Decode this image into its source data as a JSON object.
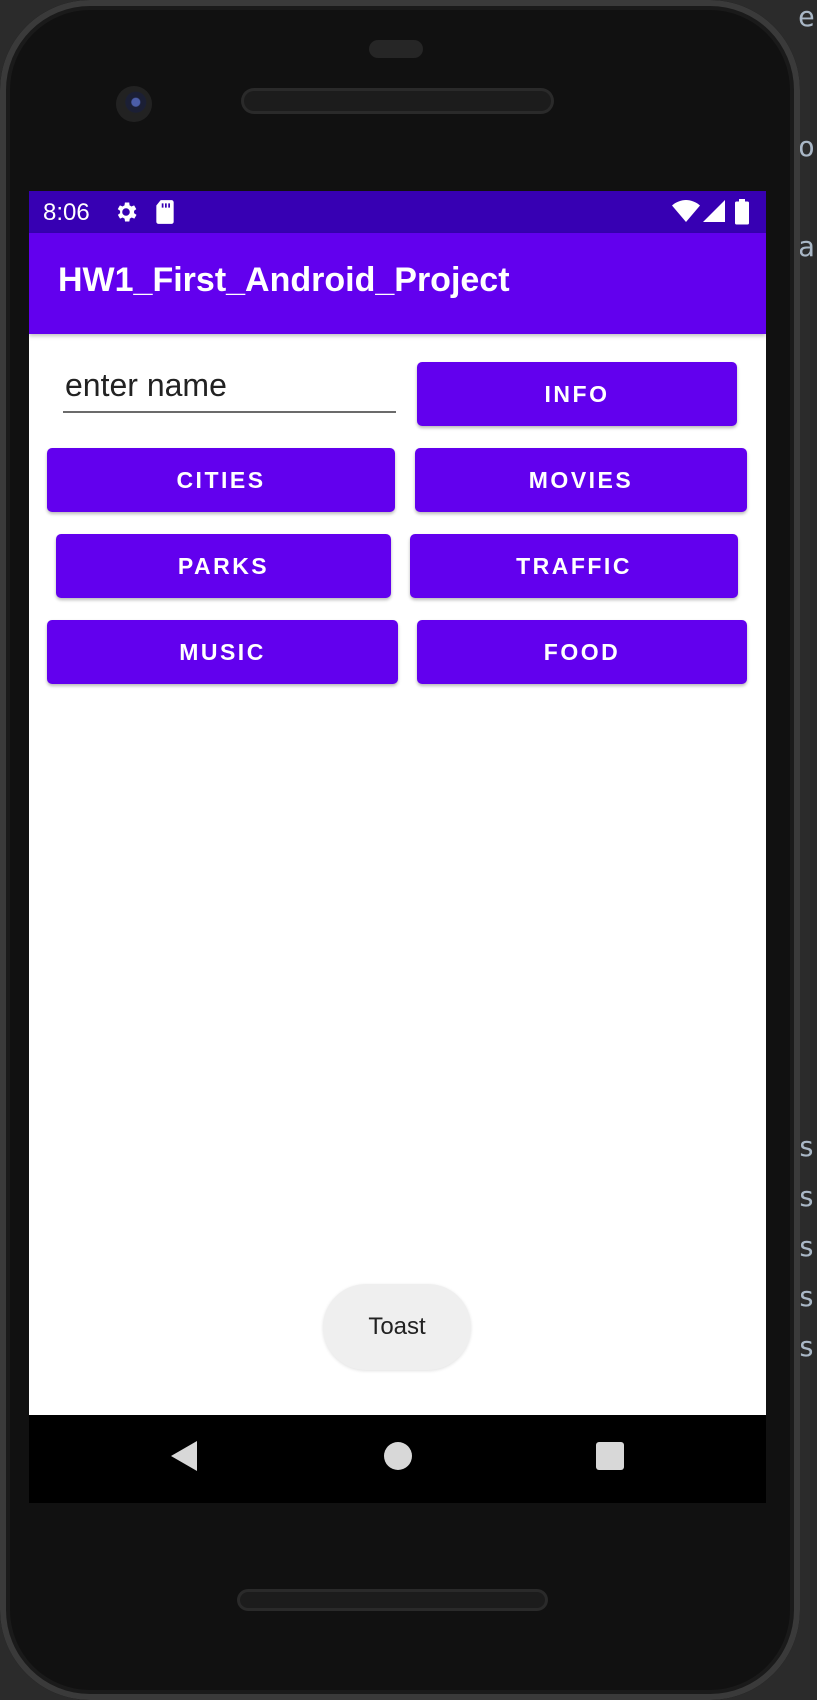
{
  "status_bar": {
    "time": "8:06",
    "icons": [
      "gear-icon",
      "sd-card-icon",
      "wifi-icon",
      "signal-icon",
      "battery-icon"
    ]
  },
  "app_bar": {
    "title": "HW1_First_Android_Project"
  },
  "name_input": {
    "placeholder": "enter name",
    "value": ""
  },
  "buttons": {
    "info": "INFO",
    "cities": "CITIES",
    "movies": "MOVIES",
    "parks": "PARKS",
    "traffic": "TRAFFIC",
    "music": "MUSIC",
    "food": "FOOD"
  },
  "toast": {
    "text": "Toast"
  },
  "navigation": {
    "icons": [
      "back-icon",
      "home-icon",
      "recents-icon"
    ]
  },
  "colors": {
    "primary": "#6200ee",
    "primary_dark": "#3700b3",
    "toast_background": "#efefef"
  }
}
